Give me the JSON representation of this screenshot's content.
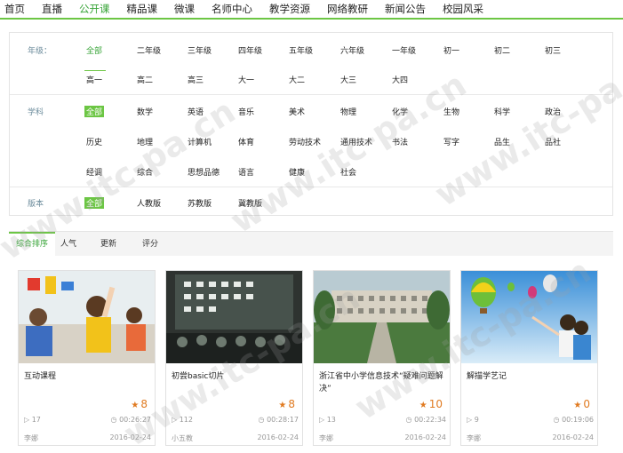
{
  "nav": [
    "首页",
    "直播",
    "公开课",
    "精品课",
    "微课",
    "名师中心",
    "教学资源",
    "网络教研",
    "新闻公告",
    "校园风采"
  ],
  "grade": {
    "label": "年级：",
    "row1": [
      "全部",
      "二年级",
      "三年级",
      "四年级",
      "五年级",
      "六年级",
      "一年级",
      "初一",
      "初二",
      "初三"
    ],
    "row2": [
      "高一",
      "高二",
      "高三",
      "大一",
      "大二",
      "大三",
      "大四"
    ]
  },
  "subject": {
    "label": "学科",
    "row1": [
      "全部",
      "数学",
      "英语",
      "音乐",
      "美术",
      "物理",
      "化学",
      "生物",
      "科学",
      "政治"
    ],
    "row2": [
      "历史",
      "地理",
      "计算机",
      "体育",
      "劳动技术",
      "通用技术",
      "书法",
      "写字",
      "品生",
      "品社"
    ],
    "row3": [
      "经调",
      "综合",
      "思想品德",
      "语言",
      "健康",
      "社会"
    ]
  },
  "version": {
    "label": "版本",
    "options": [
      "全部",
      "人教版",
      "苏教版",
      "冀教版"
    ]
  },
  "sort_tabs": [
    "综合排序",
    "人气",
    "更新",
    "评分"
  ],
  "cards": [
    {
      "title": "互动课程",
      "rating": "8",
      "plays": "17",
      "duration": "00:26:27",
      "author": "李娜",
      "date": "2016-02-24"
    },
    {
      "title": "初尝basic切片",
      "rating": "8",
      "plays": "112",
      "duration": "00:28:17",
      "author": "小五教",
      "date": "2016-02-24"
    },
    {
      "title": "浙江省中小学信息技术“疑难问题解决”",
      "rating": "10",
      "plays": "13",
      "duration": "00:22:34",
      "author": "李娜",
      "date": "2016-02-24"
    },
    {
      "title": "解描学艺记",
      "rating": "0",
      "plays": "9",
      "duration": "00:19:06",
      "author": "李娜",
      "date": "2016-02-24"
    }
  ],
  "watermark": "www.itc-pa.cn",
  "colors": {
    "accent": "#6cc644",
    "accent_text": "#3aa53a",
    "rating": "#e07a20"
  }
}
